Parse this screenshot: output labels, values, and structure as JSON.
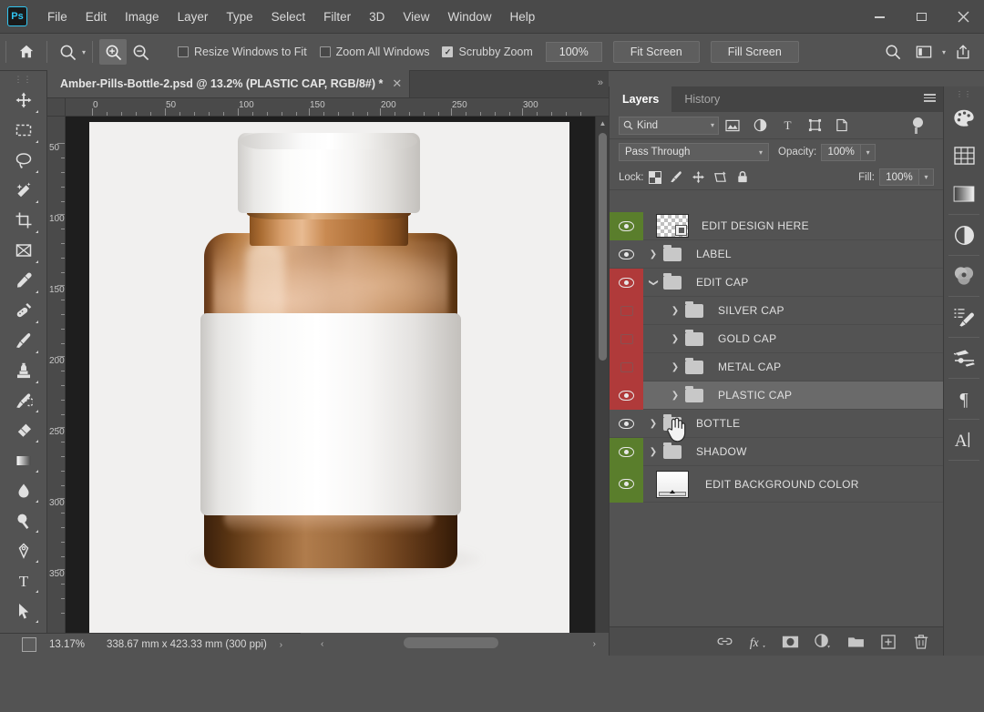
{
  "app": {
    "logo_text": "Ps",
    "menus": [
      "File",
      "Edit",
      "Image",
      "Layer",
      "Type",
      "Select",
      "Filter",
      "3D",
      "View",
      "Window",
      "Help"
    ],
    "window_controls": [
      "minimize",
      "maximize",
      "close"
    ]
  },
  "options_bar": {
    "home_icon": "home-icon",
    "tool_icon": "zoom-tool-icon",
    "zoom_in_icon": "zoom-in-icon",
    "zoom_out_icon": "zoom-out-icon",
    "checkboxes": [
      {
        "label": "Resize Windows to Fit",
        "checked": false
      },
      {
        "label": "Zoom All Windows",
        "checked": false
      },
      {
        "label": "Scrubby Zoom",
        "checked": true
      }
    ],
    "zoom_value": "100%",
    "fit_screen": "Fit Screen",
    "fill_screen": "Fill Screen",
    "right_icons": [
      "search-icon",
      "workspace-icon",
      "chevron-down-icon",
      "share-icon"
    ]
  },
  "document": {
    "tab_title": "Amber-Pills-Bottle-2.psd @ 13.2% (PLASTIC CAP, RGB/8#) *",
    "close_glyph": "✕"
  },
  "toolbar": {
    "tools": [
      {
        "name": "move-tool",
        "glyph": "move"
      },
      {
        "name": "rectangular-marquee-tool",
        "glyph": "marquee"
      },
      {
        "name": "lasso-tool",
        "glyph": "lasso"
      },
      {
        "name": "magic-wand-tool",
        "glyph": "wand"
      },
      {
        "name": "crop-tool",
        "glyph": "crop"
      },
      {
        "name": "frame-tool",
        "glyph": "frame"
      },
      {
        "name": "eyedropper-tool",
        "glyph": "eyedropper"
      },
      {
        "name": "healing-brush-tool",
        "glyph": "healing"
      },
      {
        "name": "brush-tool",
        "glyph": "brush"
      },
      {
        "name": "clone-stamp-tool",
        "glyph": "stamp"
      },
      {
        "name": "history-brush-tool",
        "glyph": "historybrush"
      },
      {
        "name": "eraser-tool",
        "glyph": "eraser"
      },
      {
        "name": "gradient-tool",
        "glyph": "gradient"
      },
      {
        "name": "blur-tool",
        "glyph": "blur"
      },
      {
        "name": "dodge-tool",
        "glyph": "dodge"
      },
      {
        "name": "pen-tool",
        "glyph": "pen"
      },
      {
        "name": "type-tool",
        "glyph": "type"
      },
      {
        "name": "path-selection-tool",
        "glyph": "pathselect"
      },
      {
        "name": "rectangle-tool",
        "glyph": "rectangle"
      }
    ]
  },
  "rulers": {
    "horizontal_ticks": [
      "0",
      "50",
      "100",
      "150",
      "200",
      "250",
      "300"
    ],
    "vertical_ticks": [
      "50",
      "100",
      "150",
      "200",
      "250",
      "300",
      "350"
    ],
    "unit": "mm"
  },
  "canvas": {
    "subject": "amber pills bottle mockup with white plastic cap and blank white label",
    "background_color": "#f1f0ef",
    "cap_color": "#ffffff",
    "glass_color": "#8a5427",
    "label_color": "#ffffff"
  },
  "status_bar": {
    "zoom": "13.17%",
    "dimensions": "338.67 mm x 423.33 mm (300 ppi)",
    "expand_glyph": "›"
  },
  "panel": {
    "tabs": [
      {
        "label": "Layers",
        "active": true
      },
      {
        "label": "History",
        "active": false
      }
    ],
    "filter": {
      "kind_label": "Kind",
      "search_icon": "search-icon",
      "icons": [
        "pixel-filter-icon",
        "adjustment-filter-icon",
        "type-filter-icon",
        "shape-filter-icon",
        "smart-object-filter-icon"
      ],
      "toggle_name": "filter-toggle"
    },
    "blend_mode": "Pass Through",
    "opacity_label": "Opacity:",
    "opacity_value": "100%",
    "lock_label": "Lock:",
    "lock_icons": [
      "lock-transparent-pixels-icon",
      "lock-image-pixels-icon",
      "lock-position-icon",
      "lock-artboard-icon",
      "lock-all-icon"
    ],
    "fill_label": "Fill:",
    "fill_value": "100%",
    "layers": [
      {
        "name": "EDIT DESIGN HERE",
        "visible": true,
        "color": "green",
        "type": "smart-object",
        "indent": 0,
        "expandable": false,
        "selected": false
      },
      {
        "name": "LABEL",
        "visible": true,
        "color": "none",
        "type": "group",
        "indent": 0,
        "expandable": true,
        "expanded": false,
        "selected": false
      },
      {
        "name": "EDIT CAP",
        "visible": true,
        "color": "red",
        "type": "group",
        "indent": 0,
        "expandable": true,
        "expanded": true,
        "selected": false
      },
      {
        "name": "SILVER CAP",
        "visible": false,
        "color": "red",
        "type": "group",
        "indent": 1,
        "expandable": true,
        "expanded": false,
        "selected": false
      },
      {
        "name": "GOLD CAP",
        "visible": false,
        "color": "red",
        "type": "group",
        "indent": 1,
        "expandable": true,
        "expanded": false,
        "selected": false
      },
      {
        "name": "METAL CAP",
        "visible": false,
        "color": "red",
        "type": "group",
        "indent": 1,
        "expandable": true,
        "expanded": false,
        "selected": false
      },
      {
        "name": "PLASTIC CAP",
        "visible": true,
        "color": "red",
        "type": "group",
        "indent": 1,
        "expandable": true,
        "expanded": false,
        "selected": true
      },
      {
        "name": "BOTTLE",
        "visible": true,
        "color": "none",
        "type": "group",
        "indent": 0,
        "expandable": true,
        "expanded": false,
        "selected": false
      },
      {
        "name": "SHADOW",
        "visible": true,
        "color": "green",
        "type": "group",
        "indent": 0,
        "expandable": true,
        "expanded": false,
        "selected": false
      },
      {
        "name": "EDIT BACKGROUND COLOR",
        "visible": true,
        "color": "green",
        "type": "solid-fill",
        "indent": 0,
        "expandable": false,
        "selected": false
      }
    ],
    "bottom_icons": [
      "link-layers-icon",
      "layer-styles-icon",
      "layer-mask-icon",
      "adjustment-layer-icon",
      "new-group-icon",
      "new-layer-icon",
      "delete-layer-icon"
    ]
  },
  "rail": {
    "items": [
      "color-panel-icon",
      "swatches-panel-icon",
      "gradients-panel-icon",
      "adjustments-panel-icon",
      "color-wheel-panel-icon",
      "brush-presets-panel-icon",
      "brush-settings-panel-icon",
      "paragraph-panel-icon",
      "character-panel-icon"
    ]
  },
  "colors": {
    "chrome": "#535353",
    "menubar": "#4a4a4a",
    "panel_tab_bg": "#444444",
    "layer_green": "#5a7e2c",
    "layer_red": "#b03a3a",
    "selected_row": "#6a6a6a",
    "accent_blue": "#31c5f0"
  }
}
